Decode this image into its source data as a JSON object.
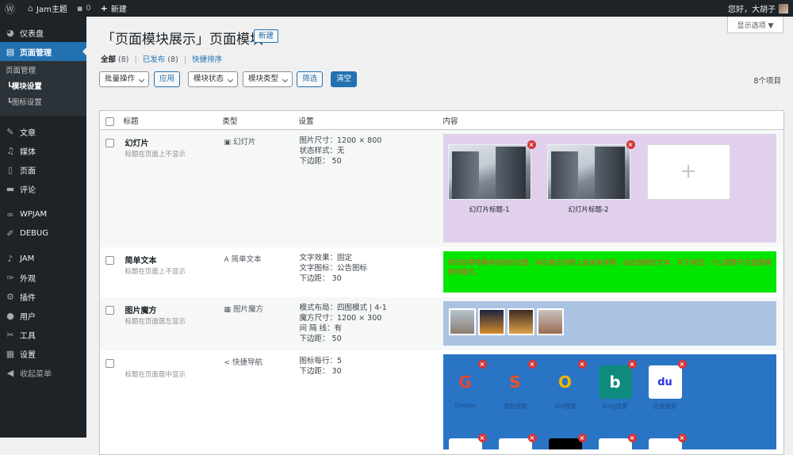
{
  "adminbar": {
    "site_name": "Jam主题",
    "comments_count": "0",
    "new_label": "新建",
    "greeting": "您好，大胡子"
  },
  "sidebar": {
    "items": [
      {
        "label": "仪表盘",
        "icon": "dashboard-icon"
      },
      {
        "label": "页面管理",
        "icon": "page-manage-icon"
      },
      {
        "label": "文章",
        "icon": "pin-icon"
      },
      {
        "label": "媒体",
        "icon": "media-icon"
      },
      {
        "label": "页面",
        "icon": "page-icon"
      },
      {
        "label": "评论",
        "icon": "comment-icon"
      },
      {
        "label": "WPJAM",
        "icon": "wpjam-icon"
      },
      {
        "label": "DEBUG",
        "icon": "debug-icon"
      },
      {
        "label": "JAM",
        "icon": "jam-icon"
      },
      {
        "label": "外观",
        "icon": "appearance-icon"
      },
      {
        "label": "插件",
        "icon": "plugin-icon"
      },
      {
        "label": "用户",
        "icon": "user-icon"
      },
      {
        "label": "工具",
        "icon": "tools-icon"
      },
      {
        "label": "设置",
        "icon": "settings-icon"
      },
      {
        "label": "收起菜单",
        "icon": "collapse-icon"
      }
    ],
    "submenu": [
      "页面管理",
      "模块设置",
      "图标设置"
    ]
  },
  "screen_options": "显示选项 ▼",
  "page": {
    "title": "「页面模块展示」页面模块",
    "new_button": "新建"
  },
  "views": {
    "all": "全部",
    "all_count": "(8)",
    "published": "已发布",
    "published_count": "(8)",
    "quick_sort": "快捷排序",
    "sep": "|"
  },
  "tablenav": {
    "bulk": "批量操作",
    "apply": "应用",
    "status": "模块状态",
    "type": "模块类型",
    "filter": "筛选",
    "clear": "清空",
    "items_count": "8个项目"
  },
  "table": {
    "headers": [
      "标题",
      "类型",
      "设置",
      "内容"
    ],
    "rows": [
      {
        "title": "幻灯片",
        "desc": "标题在页面上不显示",
        "type_icon": "▣",
        "type": "幻灯片",
        "settings": [
          "图片尺寸：1200 × 800",
          "状态样式：无",
          "下边距：  50"
        ],
        "slide_captions": [
          "幻灯片标题-1",
          "幻灯片标题-2"
        ],
        "add_symbol": "+"
      },
      {
        "title": "简单文本",
        "desc": "标题在页面上不显示",
        "type_icon": "A",
        "type": "简单文本",
        "settings": [
          "文字效果：固定",
          "文字图标：公告图标",
          "下边距：  30"
        ],
        "text": "时间在那顿模块绕前的设置。将在展示的眼上面采用来明，由此做频的文本，关于按钮，什么都是不过或是播放的模式。"
      },
      {
        "title": "图片魔方",
        "desc": "标题在页面居左显示",
        "type_icon": "▦",
        "type": "图片魔方",
        "settings": [
          "模式布局：四图模式 | 4-1",
          "魔方尺寸：1200 × 300",
          "间  隔  线：有",
          "下边距：  50"
        ]
      },
      {
        "title": "",
        "desc": "标题在页面居中显示",
        "type_icon": "<",
        "type": "快捷导航",
        "settings": [
          "图标每行：5",
          "下边距：  30"
        ],
        "nav_labels": [
          "Google",
          "搜狗搜索",
          "360搜索",
          "Bing搜索",
          "百度搜索"
        ]
      }
    ]
  },
  "colors": {
    "admin_bg": "#1d2327",
    "accent": "#2271b1",
    "slide_panel": "#e0d0eb",
    "text_panel": "#00e600",
    "cube_panel": "#aac3e3",
    "nav_panel": "#2a74c6"
  }
}
